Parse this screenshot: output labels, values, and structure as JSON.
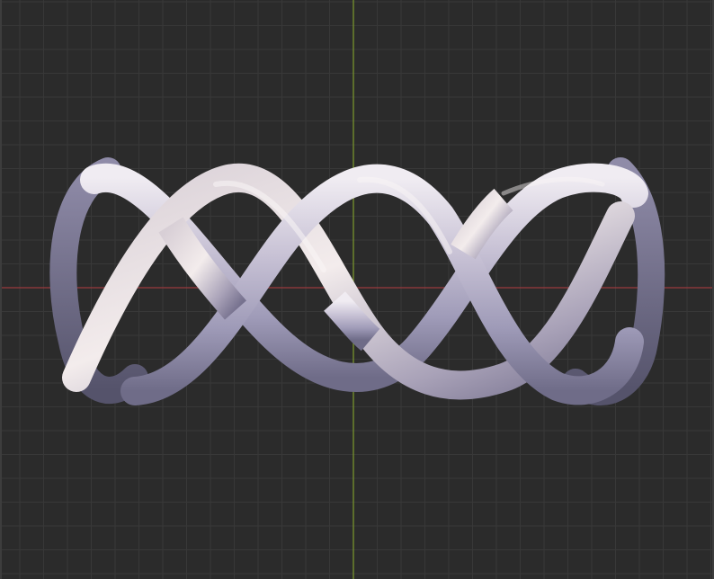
{
  "viewport": {
    "view": "3d-viewport",
    "background_color": "#2b2b2b",
    "grid": {
      "visible": true,
      "minor_color": "#383838",
      "major_color": "#444444"
    },
    "axes": {
      "x_axis_color": "#9a3a3e",
      "y_axis_color": "#7d9a2e"
    },
    "model": {
      "object": "braided-ring",
      "strands": 3,
      "material_color": "#b7b4cc",
      "highlight_color": "#efe9ee",
      "shadow_color": "#6e6c86"
    }
  }
}
